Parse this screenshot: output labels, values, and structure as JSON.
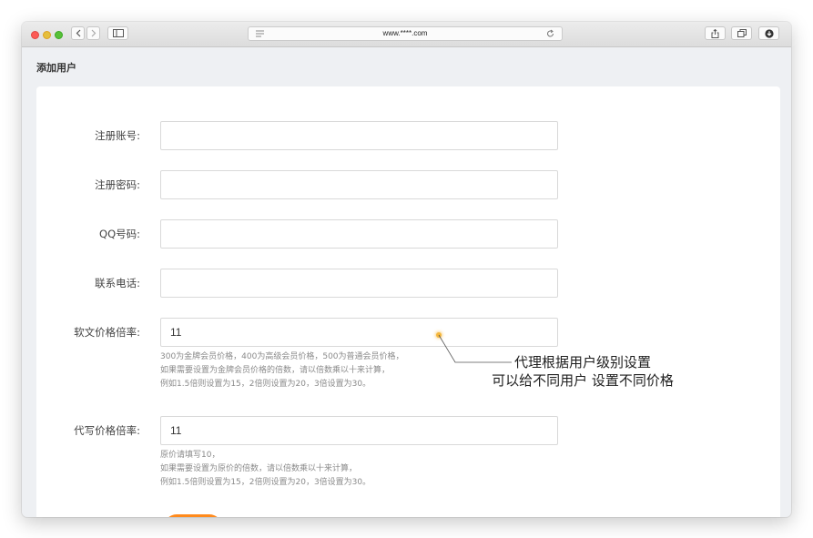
{
  "browser": {
    "url": "www.****.com",
    "icons": [
      "back-icon",
      "forward-icon",
      "sidebar-icon",
      "reader-icon",
      "reload-icon",
      "share-icon",
      "tabs-icon",
      "downloads-icon"
    ]
  },
  "page": {
    "title": "添加用户"
  },
  "form": {
    "username": {
      "label": "注册账号:",
      "value": ""
    },
    "password": {
      "label": "注册密码:",
      "value": ""
    },
    "qq": {
      "label": "QQ号码:",
      "value": ""
    },
    "phone": {
      "label": "联系电话:",
      "value": ""
    },
    "article_rate": {
      "label": "软文价格倍率:",
      "value": "11",
      "hint": [
        "300为金牌会员价格，400为高级会员价格，500为普通会员价格，",
        "如果需要设置为金牌会员价格的倍数，请以倍数乘以十来计算，",
        "例如1.5倍则设置为15，2倍则设置为20，3倍设置为30。"
      ]
    },
    "writing_rate": {
      "label": "代写价格倍率:",
      "value": "11",
      "hint": [
        "原价请填写10，",
        "如果需要设置为原价的倍数，请以倍数乘以十来计算，",
        "例如1.5倍则设置为15，2倍则设置为20，3倍设置为30。"
      ]
    }
  },
  "annotation": {
    "lines": [
      "代理根据用户级别设置",
      "可以给不同用户 设置不同价格"
    ],
    "accent": "#f6b73c"
  },
  "colors": {
    "primary": "#ff8a1c"
  }
}
